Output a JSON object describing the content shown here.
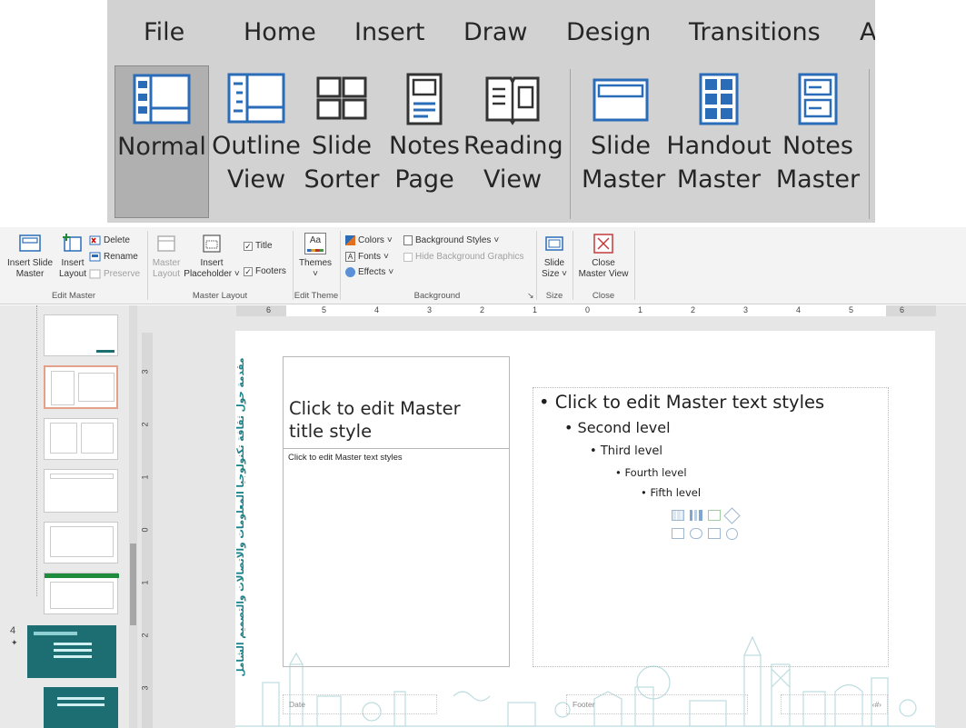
{
  "zoom_ribbon": {
    "tabs": [
      "File",
      "Home",
      "Insert",
      "Draw",
      "Design",
      "Transitions",
      "A"
    ],
    "buttons": [
      {
        "line1": "Normal",
        "line2": ""
      },
      {
        "line1": "Outline",
        "line2": "View"
      },
      {
        "line1": "Slide",
        "line2": "Sorter"
      },
      {
        "line1": "Notes",
        "line2": "Page"
      },
      {
        "line1": "Reading",
        "line2": "View"
      },
      {
        "line1": "Slide",
        "line2": "Master"
      },
      {
        "line1": "Handout",
        "line2": "Master"
      },
      {
        "line1": "Notes",
        "line2": "Master"
      }
    ]
  },
  "ribbon": {
    "insert_slide_master": "Insert Slide Master",
    "insert_slide_master_l1": "Insert Slide",
    "insert_slide_master_l2": "Master",
    "insert_layout_l1": "Insert",
    "insert_layout_l2": "Layout",
    "delete": "Delete",
    "rename": "Rename",
    "preserve": "Preserve",
    "group_edit_master": "Edit Master",
    "master_layout_l1": "Master",
    "master_layout_l2": "Layout",
    "insert_placeholder_l1": "Insert",
    "insert_placeholder_l2": "Placeholder",
    "title_chk": "Title",
    "footers_chk": "Footers",
    "group_master_layout": "Master Layout",
    "themes": "Themes",
    "themes_icon_text": "Aa",
    "group_edit_theme": "Edit Theme",
    "colors": "Colors",
    "fonts": "Fonts",
    "effects": "Effects",
    "background_styles": "Background Styles",
    "hide_bg_graphics": "Hide Background Graphics",
    "group_background": "Background",
    "slide_size_l1": "Slide",
    "slide_size_l2": "Size",
    "group_size": "Size",
    "close_l1": "Close",
    "close_l2": "Master View",
    "group_close": "Close"
  },
  "rulers": {
    "h_labels": [
      "6",
      "5",
      "4",
      "3",
      "2",
      "1",
      "0",
      "1",
      "2",
      "3",
      "4",
      "5",
      "6"
    ],
    "v_labels": [
      "3",
      "2",
      "1",
      "0",
      "1",
      "2",
      "3"
    ]
  },
  "thumbnails": {
    "slide_number": "4"
  },
  "slide": {
    "title": "Click to edit Master title style",
    "left_body": "Click to edit Master text styles",
    "levels": [
      "Click to edit Master text styles",
      "Second level",
      "Third level",
      "Fourth level",
      "Fifth level"
    ],
    "side_text": "مقدمة حول ثقافة تكنولوجيا المعلومات والاتصالات والتصميم الشامل",
    "footer_date": "Date",
    "footer_text": "Footer",
    "footer_num": "‹#›"
  }
}
